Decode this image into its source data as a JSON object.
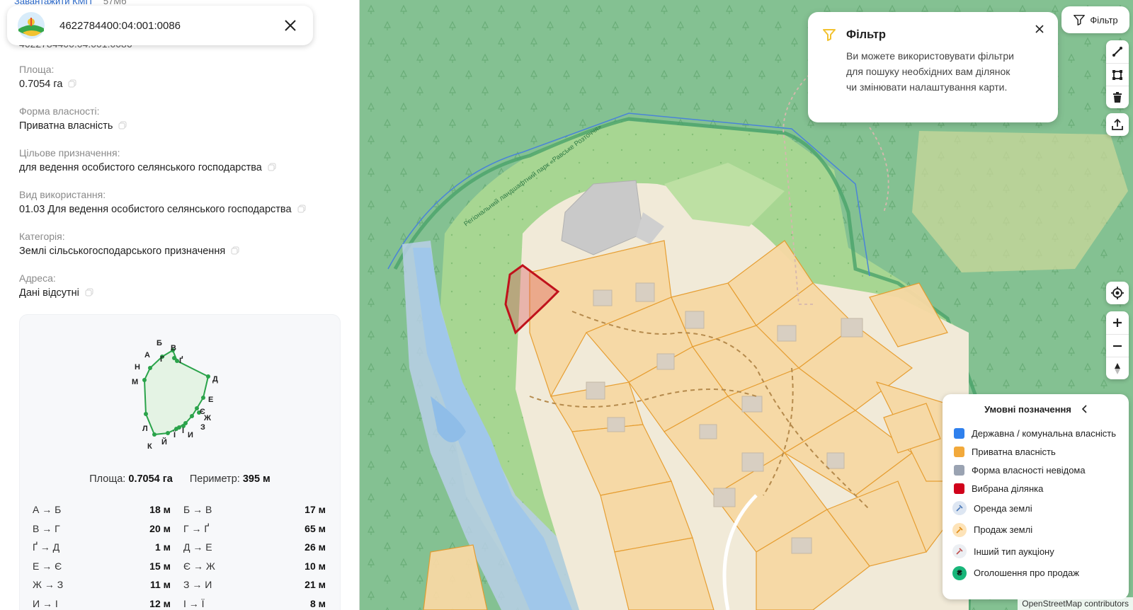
{
  "panel": {
    "top_link": "Завантажити КМП",
    "top_size": "57Мб",
    "under_card_text": "4622784400:04:001:0086",
    "search_value": "4622784400:04:001:0086",
    "fields": [
      {
        "label": "Площа:",
        "value": "0.7054 га"
      },
      {
        "label": "Форма власності:",
        "value": "Приватна власність"
      },
      {
        "label": "Цільове призначення:",
        "value": "для ведення особистого селянського господарства"
      },
      {
        "label": "Вид використання:",
        "value": "01.03 Для ведення особистого селянського господарства"
      },
      {
        "label": "Категорія:",
        "value": "Землі сільськогосподарського призначення"
      },
      {
        "label": "Адреса:",
        "value": "Дані відсутні"
      }
    ],
    "geometry": {
      "vertices": [
        "А",
        "Б",
        "В",
        "Г",
        "Ґ",
        "Д",
        "Е",
        "Є",
        "Ж",
        "З",
        "И",
        "І",
        "Ї",
        "Й",
        "К",
        "Л",
        "М",
        "Н"
      ],
      "area_label": "Площа:",
      "area_value": "0.7054 га",
      "perimeter_label": "Периметр:",
      "perimeter_value": "395 м",
      "segments": [
        [
          {
            "name": "А → Б",
            "len": "18 м"
          },
          {
            "name": "Б → В",
            "len": "17 м"
          }
        ],
        [
          {
            "name": "В → Г",
            "len": "20 м"
          },
          {
            "name": "Г → Ґ",
            "len": "65 м"
          }
        ],
        [
          {
            "name": "Ґ → Д",
            "len": "1 м"
          },
          {
            "name": "Д → Е",
            "len": "26 м"
          }
        ],
        [
          {
            "name": "Е → Є",
            "len": "15 м"
          },
          {
            "name": "Є → Ж",
            "len": "10 м"
          }
        ],
        [
          {
            "name": "Ж → З",
            "len": "11 м"
          },
          {
            "name": "З → И",
            "len": "21 м"
          }
        ],
        [
          {
            "name": "И → І",
            "len": "12 м"
          },
          {
            "name": "І → Ї",
            "len": "8 м"
          }
        ]
      ]
    }
  },
  "map": {
    "park_label": "Регіональний ландшафтний парк «Равське Розточчя»",
    "tooltip": {
      "title": "Фільтр",
      "text": "Ви можете використовувати фільтри для пошуку необхідних вам ділянок чи змінювати налаштування карти."
    },
    "filter_button": "Фільтр",
    "legend": {
      "title": "Умовні позначення",
      "items": [
        {
          "label": "Державна / комунальна власність",
          "color": "#2f80ed"
        },
        {
          "label": "Приватна власність",
          "color": "#f2a93b"
        },
        {
          "label": "Форма власності невідома",
          "color": "#9aa3b2"
        },
        {
          "label": "Вибрана ділянка",
          "color": "#d0021b"
        },
        {
          "label": "Оренда землі",
          "color": "#dde6f2",
          "icon": "rent-icon"
        },
        {
          "label": "Продаж землі",
          "color": "#fde3b8",
          "icon": "sale-icon"
        },
        {
          "label": "Інший тип аукціону",
          "color": "#eceff3",
          "icon": "auction-icon"
        },
        {
          "label": "Оголошення про продаж",
          "color": "#18b67a",
          "icon_text": "₴"
        }
      ]
    },
    "attribution": "OpenStreetMap contributors"
  },
  "colors": {
    "forest": "#7fbf8d",
    "forest_light": "#a8d496",
    "water": "#a9cdea",
    "private": "#f6d9a6",
    "selected": "#c0121b",
    "boundary": "#3d9a5a"
  }
}
